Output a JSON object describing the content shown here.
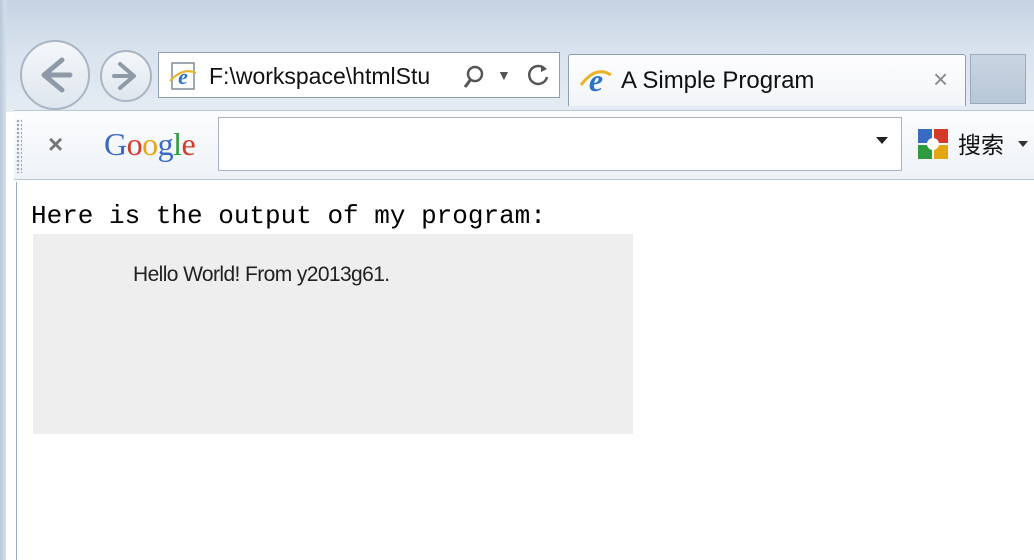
{
  "browser": {
    "address_bar": {
      "value": "F:\\workspace\\htmlStu",
      "icons": [
        "ie-page-icon",
        "search-icon",
        "dropdown-arrow-icon",
        "refresh-icon"
      ]
    },
    "navigation": {
      "back_icon": "back-arrow-icon",
      "forward_icon": "forward-arrow-icon"
    },
    "tab": {
      "title": "A Simple Program",
      "icon": "ie-page-icon",
      "close_label": "×"
    },
    "new_tab": {
      "icon": "new-tab"
    }
  },
  "toolbar": {
    "close_label": "×",
    "logo_text": [
      "G",
      "o",
      "o",
      "g",
      "l",
      "e"
    ],
    "search_input": {
      "value": ""
    },
    "search_button": {
      "label": "搜索",
      "icon": "google-search-icon"
    }
  },
  "page": {
    "heading": "Here is the output of my program:",
    "output_text": "Hello World! From y2013g61."
  },
  "colors": {
    "chrome_blue": "#c5d3e3",
    "output_box_bg": "#eeeeee",
    "google_blue": "#3a69c6",
    "google_red": "#d23b2a",
    "google_yellow": "#e5a614",
    "google_green": "#2f9a3e"
  }
}
